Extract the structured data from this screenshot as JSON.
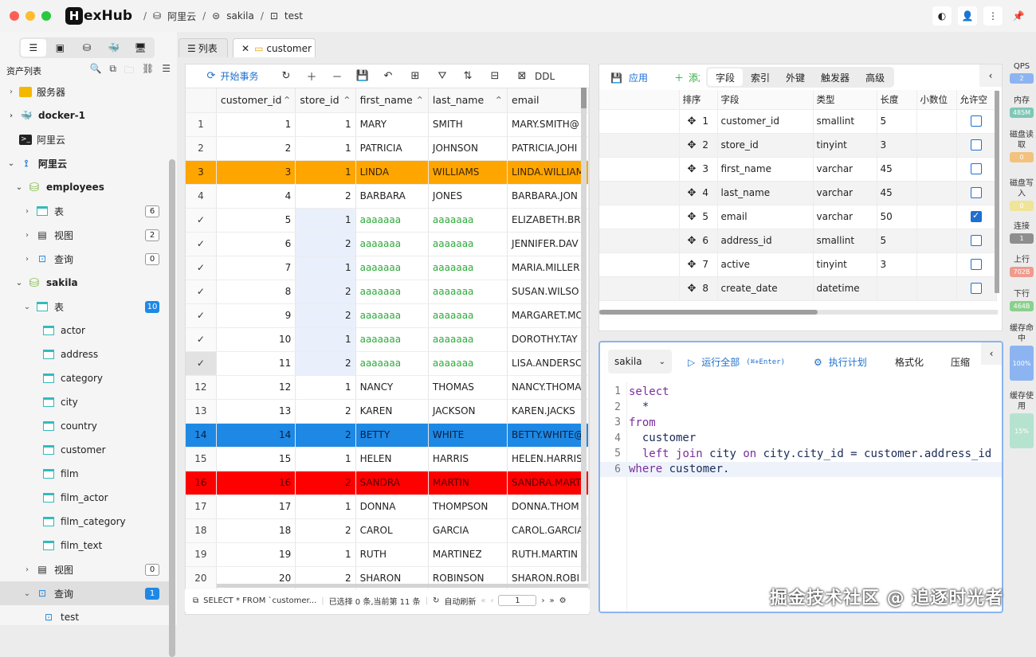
{
  "app": {
    "name": "HexHub"
  },
  "breadcrumbs": [
    "阿里云",
    "sakila",
    "test"
  ],
  "sidebar": {
    "title": "资产列表",
    "tree": [
      {
        "label": "服务器",
        "count": ""
      },
      {
        "label": "docker-1",
        "count": ""
      },
      {
        "label": "阿里云",
        "count": ""
      },
      {
        "label": "阿里云",
        "count": ""
      },
      {
        "label": "employees",
        "count": ""
      },
      {
        "label": "表",
        "count": "6"
      },
      {
        "label": "视图",
        "count": "2"
      },
      {
        "label": "查询",
        "count": "0"
      },
      {
        "label": "sakila",
        "count": ""
      },
      {
        "label": "表",
        "count": "10"
      },
      {
        "label": "actor",
        "count": ""
      },
      {
        "label": "address",
        "count": ""
      },
      {
        "label": "category",
        "count": ""
      },
      {
        "label": "city",
        "count": ""
      },
      {
        "label": "country",
        "count": ""
      },
      {
        "label": "customer",
        "count": ""
      },
      {
        "label": "film",
        "count": ""
      },
      {
        "label": "film_actor",
        "count": ""
      },
      {
        "label": "film_category",
        "count": ""
      },
      {
        "label": "film_text",
        "count": ""
      },
      {
        "label": "视图",
        "count": "0"
      },
      {
        "label": "查询",
        "count": "1"
      },
      {
        "label": "test",
        "count": ""
      }
    ]
  },
  "tabs": [
    {
      "label": "列表"
    },
    {
      "label": "customer"
    }
  ],
  "grid": {
    "toolbar": {
      "begin_tx": "开始事务",
      "ddl": "DDL"
    },
    "columns": [
      "customer_id",
      "store_id",
      "first_name",
      "last_name",
      "email"
    ],
    "rows": [
      {
        "rn": "1",
        "id": "1",
        "store": "1",
        "first": "MARY",
        "last": "SMITH",
        "email": "MARY.SMITH@",
        "style": ""
      },
      {
        "rn": "2",
        "id": "2",
        "store": "1",
        "first": "PATRICIA",
        "last": "JOHNSON",
        "email": "PATRICIA.JOHI",
        "style": ""
      },
      {
        "rn": "3",
        "id": "3",
        "store": "1",
        "first": "LINDA",
        "last": "WILLIAMS",
        "email": "LINDA.WILLIAM",
        "style": "orange"
      },
      {
        "rn": "4",
        "id": "4",
        "store": "2",
        "first": "BARBARA",
        "last": "JONES",
        "email": "BARBARA.JON",
        "style": ""
      },
      {
        "rn": "✓",
        "id": "5",
        "store": "1",
        "first": "aaaaaaa",
        "last": "aaaaaaa",
        "email": "ELIZABETH.BR",
        "style": "edited"
      },
      {
        "rn": "✓",
        "id": "6",
        "store": "2",
        "first": "aaaaaaa",
        "last": "aaaaaaa",
        "email": "JENNIFER.DAV",
        "style": "edited"
      },
      {
        "rn": "✓",
        "id": "7",
        "store": "1",
        "first": "aaaaaaa",
        "last": "aaaaaaa",
        "email": "MARIA.MILLER",
        "style": "edited"
      },
      {
        "rn": "✓",
        "id": "8",
        "store": "2",
        "first": "aaaaaaa",
        "last": "aaaaaaa",
        "email": "SUSAN.WILSO",
        "style": "edited"
      },
      {
        "rn": "✓",
        "id": "9",
        "store": "2",
        "first": "aaaaaaa",
        "last": "aaaaaaa",
        "email": "MARGARET.MC",
        "style": "edited"
      },
      {
        "rn": "✓",
        "id": "10",
        "store": "1",
        "first": "aaaaaaa",
        "last": "aaaaaaa",
        "email": "DOROTHY.TAY",
        "style": "edited"
      },
      {
        "rn": "✓",
        "id": "11",
        "store": "2",
        "first": "aaaaaaa",
        "last": "aaaaaaa",
        "email": "LISA.ANDERSC",
        "style": "edited rowsel"
      },
      {
        "rn": "12",
        "id": "12",
        "store": "1",
        "first": "NANCY",
        "last": "THOMAS",
        "email": "NANCY.THOMA",
        "style": ""
      },
      {
        "rn": "13",
        "id": "13",
        "store": "2",
        "first": "KAREN",
        "last": "JACKSON",
        "email": "KAREN.JACKS",
        "style": ""
      },
      {
        "rn": "14",
        "id": "14",
        "store": "2",
        "first": "BETTY",
        "last": "WHITE",
        "email": "BETTY.WHITE@",
        "style": "blue"
      },
      {
        "rn": "15",
        "id": "15",
        "store": "1",
        "first": "HELEN",
        "last": "HARRIS",
        "email": "HELEN.HARRIS",
        "style": ""
      },
      {
        "rn": "16",
        "id": "16",
        "store": "2",
        "first": "SANDRA",
        "last": "MARTIN",
        "email": "SANDRA.MART",
        "style": "red"
      },
      {
        "rn": "17",
        "id": "17",
        "store": "1",
        "first": "DONNA",
        "last": "THOMPSON",
        "email": "DONNA.THOM",
        "style": ""
      },
      {
        "rn": "18",
        "id": "18",
        "store": "2",
        "first": "CAROL",
        "last": "GARCIA",
        "email": "CAROL.GARCIA",
        "style": ""
      },
      {
        "rn": "19",
        "id": "19",
        "store": "1",
        "first": "RUTH",
        "last": "MARTINEZ",
        "email": "RUTH.MARTIN",
        "style": ""
      },
      {
        "rn": "20",
        "id": "20",
        "store": "2",
        "first": "SHARON",
        "last": "ROBINSON",
        "email": "SHARON.ROBI",
        "style": ""
      }
    ],
    "status": {
      "query": "SELECT * FROM `customer...",
      "selection": "已选择 0 条,当前第 11 条",
      "auto_refresh": "自动刷新",
      "page": "1"
    }
  },
  "schema": {
    "apply_label": "应用",
    "add_label": "添加",
    "segments": [
      "字段",
      "索引",
      "外键",
      "触发器",
      "高级"
    ],
    "columns": [
      "排序",
      "字段",
      "类型",
      "长度",
      "小数位",
      "允许空"
    ],
    "rows": [
      {
        "order": "1",
        "field": "customer_id",
        "type": "smallint",
        "length": "5",
        "nullable": false
      },
      {
        "order": "2",
        "field": "store_id",
        "type": "tinyint",
        "length": "3",
        "nullable": false
      },
      {
        "order": "3",
        "field": "first_name",
        "type": "varchar",
        "length": "45",
        "nullable": false
      },
      {
        "order": "4",
        "field": "last_name",
        "type": "varchar",
        "length": "45",
        "nullable": false
      },
      {
        "order": "5",
        "field": "email",
        "type": "varchar",
        "length": "50",
        "nullable": true
      },
      {
        "order": "6",
        "field": "address_id",
        "type": "smallint",
        "length": "5",
        "nullable": false
      },
      {
        "order": "7",
        "field": "active",
        "type": "tinyint",
        "length": "3",
        "nullable": false
      },
      {
        "order": "8",
        "field": "create_date",
        "type": "datetime",
        "length": "",
        "nullable": false
      }
    ]
  },
  "editor": {
    "database": "sakila",
    "run_all": "运行全部",
    "run_all_shortcut": "(⌘+Enter)",
    "explain": "执行计划",
    "format": "格式化",
    "compress": "压缩",
    "lines": [
      {
        "n": "1",
        "code": "select"
      },
      {
        "n": "2",
        "code": "  *"
      },
      {
        "n": "3",
        "code": "from"
      },
      {
        "n": "4",
        "code": "  customer"
      },
      {
        "n": "5",
        "code": "  left join city on city.city_id = customer.address_id"
      },
      {
        "n": "6",
        "code": "where customer."
      }
    ]
  },
  "monitor": [
    {
      "label": "QPS",
      "value": "2",
      "color": "#8cb4f0"
    },
    {
      "label": "内存",
      "value": "485M",
      "color": "#7fc7b6"
    },
    {
      "label": "磁盘读取",
      "value": "0",
      "color": "#f2c27e"
    },
    {
      "label": "磁盘写入",
      "value": "0",
      "color": "#f0e39a"
    },
    {
      "label": "连接",
      "value": "1",
      "color": "#8e8e8e"
    },
    {
      "label": "上行",
      "value": "702B",
      "color": "#f09a8e"
    },
    {
      "label": "下行",
      "value": "464B",
      "color": "#8ad08e"
    },
    {
      "label": "缓存命中",
      "value": "100%",
      "color": "#8cb4f0"
    },
    {
      "label": "缓存使用",
      "value": "15%",
      "color": "#b6e3cf"
    }
  ],
  "watermark": "掘金技术社区 @ 追逐时光者"
}
